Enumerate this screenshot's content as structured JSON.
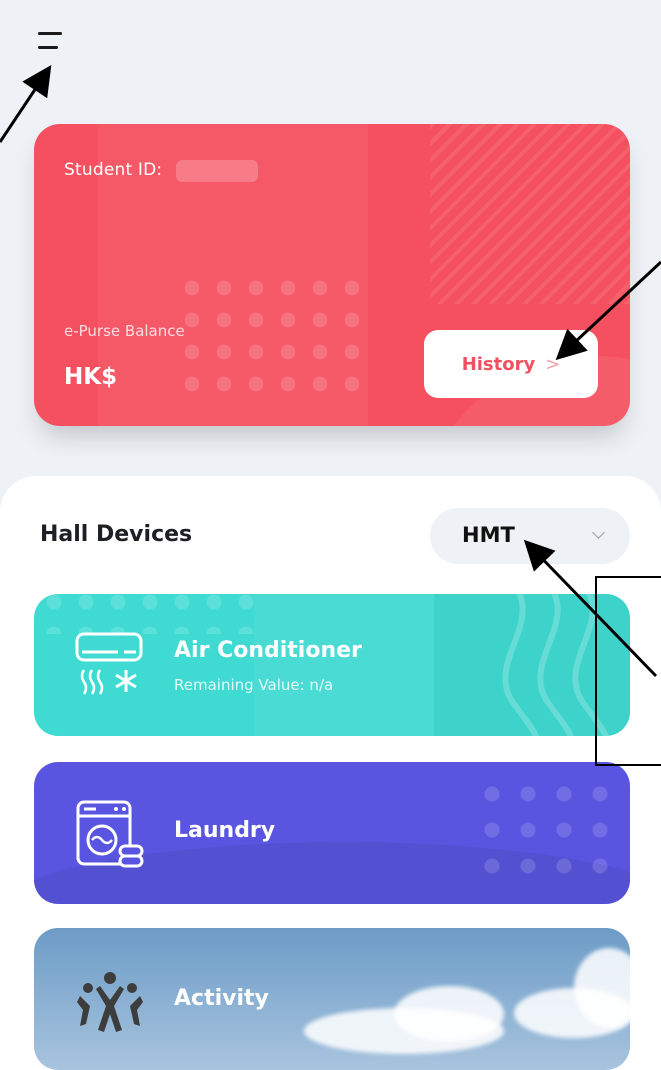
{
  "card": {
    "student_id_label": "Student ID:",
    "balance_label": "e-Purse Balance",
    "currency": "HK$",
    "history_label": "History",
    "history_chevron": ">"
  },
  "devices": {
    "section_title": "Hall Devices",
    "hall_selected": "HMT",
    "items": [
      {
        "title": "Air Conditioner",
        "subtitle": "Remaining Value: n/a",
        "color": "#3fdad2",
        "icon": "air-conditioner-icon"
      },
      {
        "title": "Laundry",
        "color": "#5a55e0",
        "icon": "washing-machine-icon"
      },
      {
        "title": "Activity",
        "color": "#7ea8cf",
        "icon": "people-activity-icon"
      }
    ]
  },
  "colors": {
    "card_red": "#f5505f",
    "page_bg": "#eef2f6"
  },
  "icons": [
    "menu-icon",
    "chevron-right-icon",
    "chevron-down-icon"
  ]
}
